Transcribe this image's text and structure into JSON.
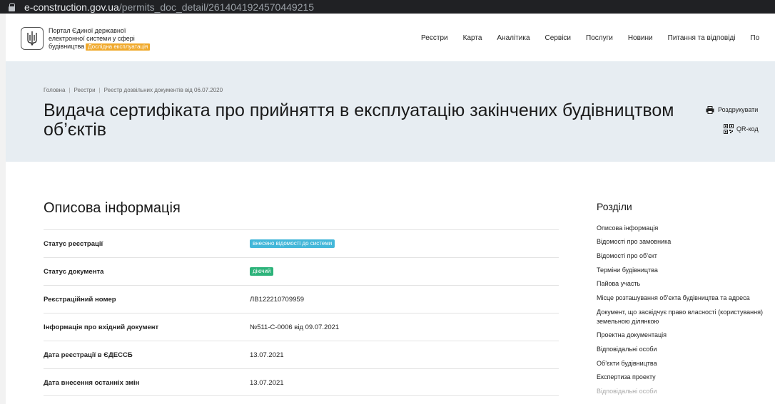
{
  "browser": {
    "domain": "e-construction.gov.ua",
    "path": "/permits_doc_detail/2614041924570449215"
  },
  "header": {
    "portal_line1": "Портал Єдиної державної",
    "portal_line2": "електронної системи у сфері",
    "portal_line3": "будівництва",
    "badge": "Дослідна експлуатація",
    "nav": [
      "Реєстри",
      "Карта",
      "Аналітика",
      "Сервіси",
      "Послуги",
      "Новини",
      "Питання та відповіді",
      "По"
    ]
  },
  "breadcrumb": [
    "Головна",
    "Реєстри",
    "Реєстр дозвільних документів від 06.07.2020"
  ],
  "page_title": "Видача сертифіката про прийняття в експлуатацію закінчених будівництвом об’єктів",
  "actions": {
    "print": "Роздрукувати",
    "qr": "QR-код"
  },
  "main": {
    "section_title": "Описова інформація",
    "rows": [
      {
        "label": "Статус реєстрації",
        "badge": "внесено відомості до системи",
        "badge_color": "#43b7d9"
      },
      {
        "label": "Статус документа",
        "badge": "діючий",
        "badge_color": "#2db37a"
      },
      {
        "label": "Реєстраційний номер",
        "value": "ЛВ122210709959"
      },
      {
        "label": "Інформація про вхідний документ",
        "value": "№511-С-0006 від 09.07.2021"
      },
      {
        "label": "Дата реєстрації в ЄДЕССБ",
        "value": "13.07.2021"
      },
      {
        "label": "Дата внесення останніх змін",
        "value": "13.07.2021"
      }
    ]
  },
  "sidebar": {
    "title": "Розділи",
    "items": [
      "Описова інформація",
      "Відомості про замовника",
      "Відомості про об’єкт",
      "Терміни будівництва",
      "Пайова участь",
      "Місце розташування об’єкта будівництва та адреса",
      "Документ, що засвідчує право власності (користування) земельною ділянкою",
      "Проектна документація",
      "Відповідальні особи",
      "Об’єкти будівництва",
      "Експертиза проекту",
      "Відповідальні особи"
    ]
  }
}
